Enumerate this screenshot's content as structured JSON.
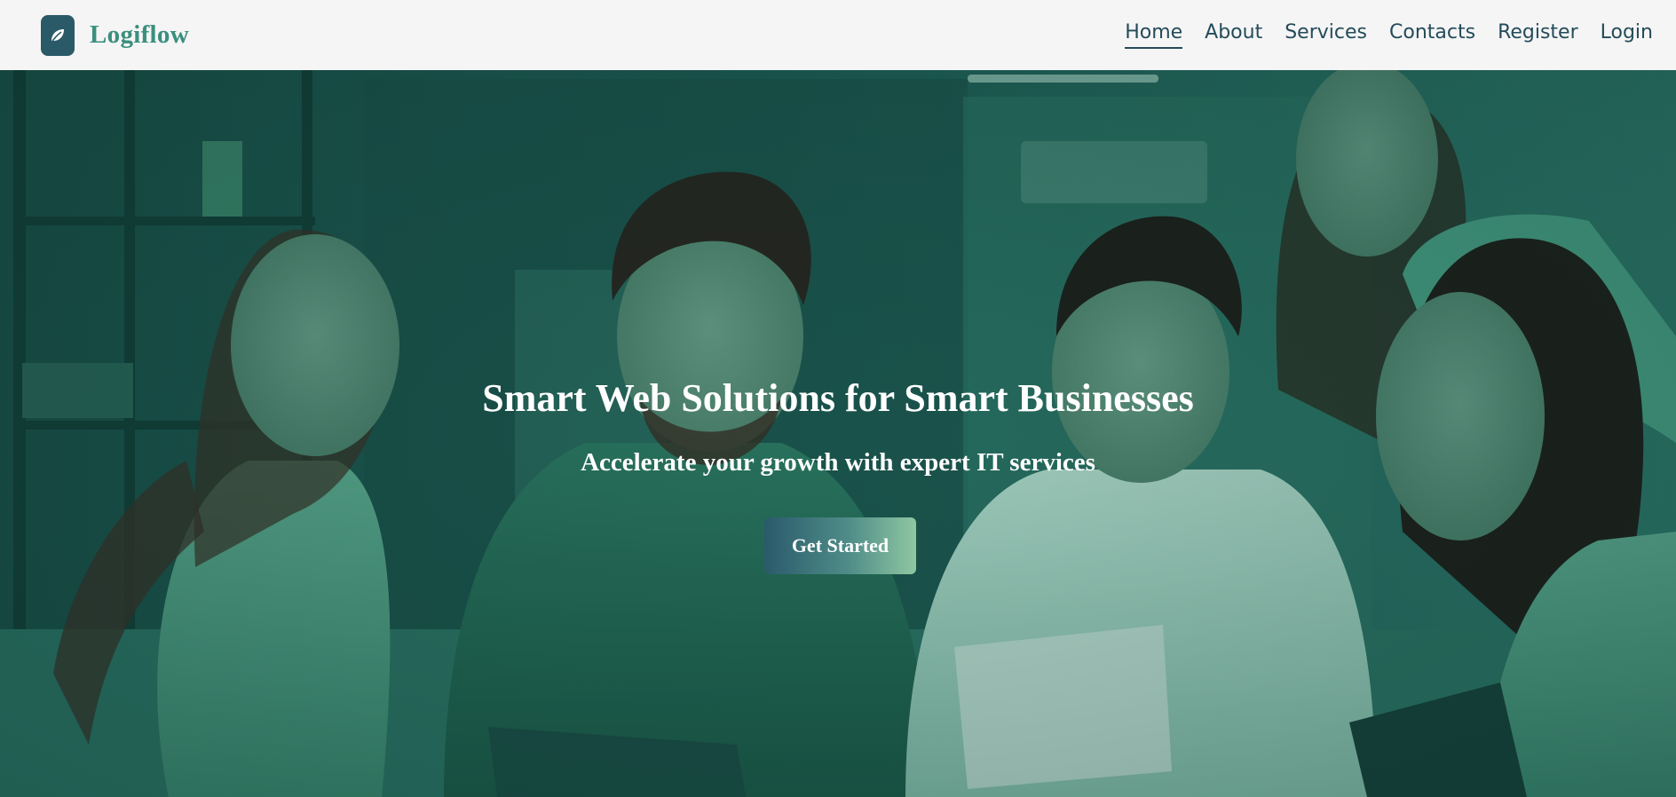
{
  "brand": {
    "name": "Logiflow",
    "logo_icon": "leaf-icon"
  },
  "nav": {
    "items": [
      {
        "label": "Home",
        "active": true
      },
      {
        "label": "About",
        "active": false
      },
      {
        "label": "Services",
        "active": false
      },
      {
        "label": "Contacts",
        "active": false
      },
      {
        "label": "Register",
        "active": false
      },
      {
        "label": "Login",
        "active": false
      }
    ]
  },
  "hero": {
    "title": "Smart Web Solutions for Smart Businesses",
    "subtitle": "Accelerate your growth with expert IT services",
    "cta_label": "Get Started"
  },
  "colors": {
    "brand": "#3b8f7e",
    "nav_text": "#244b5a",
    "logo_bg": "#2a5a67",
    "hero_tint": "#1d5d54"
  }
}
